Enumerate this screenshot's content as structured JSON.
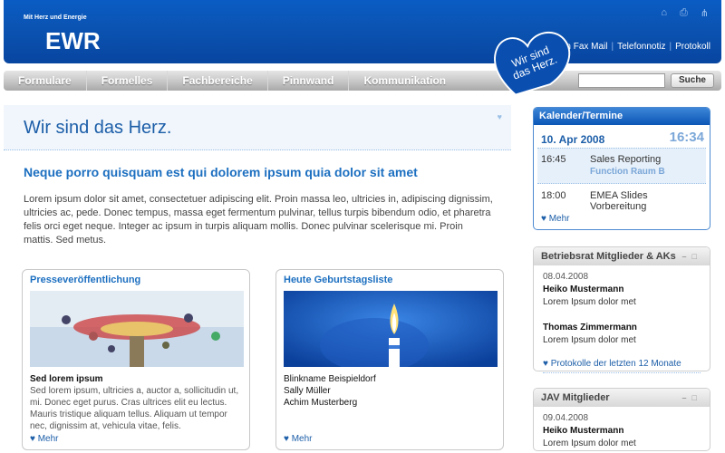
{
  "header": {
    "tagline": "Mit Herz und Energie",
    "logo": "EWR",
    "links": [
      "Fon Fax Mail",
      "Telefonnotiz",
      "Protokoll"
    ],
    "icons": [
      "home-icon",
      "print-icon",
      "sitemap-icon"
    ]
  },
  "nav": {
    "items": [
      "Formulare",
      "Formelles",
      "Fachbereiche",
      "Pinnwand",
      "Kommunikation"
    ]
  },
  "search": {
    "placeholder": "",
    "button_label": "Suche"
  },
  "badge": {
    "text": "Wir sind das Herz."
  },
  "main": {
    "title": "Wir sind das Herz.",
    "headline": "Neque porro quisquam est qui dolorem ipsum quia dolor sit amet",
    "intro": "Lorem ipsum dolor sit amet, consectetuer adipiscing elit. Proin massa leo, ultricies in, adipiscing dignissim, ultricies ac, pede. Donec tempus, massa eget fermentum pulvinar, tellus turpis bibendum odio, et pharetra felis orci eget neque. Integer ac ipsum in turpis aliquam mollis. Donec pulvinar scelerisque mi. Proin mattis. Sed metus."
  },
  "teasers": [
    {
      "title": "Presseveröffentlichung",
      "subtitle": "Sed lorem ipsum",
      "text": "Sed lorem ipsum, ultricies a, auctor a, sollicitudin ut, mi. Donec eget purus. Cras ultrices elit eu lectus. Mauris tristique aliquam tellus. Aliquam ut tempor nec, dignissim at, vehicula vitae, felis.",
      "more": "Mehr"
    },
    {
      "title": "Heute Geburtstagsliste",
      "lines": [
        "Blinkname Beispieldorf",
        "Sally Müller",
        "Achim Musterberg"
      ],
      "more": "Mehr"
    }
  ],
  "calendar": {
    "title": "Kalender/Termine",
    "date": "10. Apr 2008",
    "clock": "16:34",
    "events": [
      {
        "time": "16:45",
        "title": "Sales Reporting",
        "location": "Function Raum B"
      },
      {
        "time": "18:00",
        "title": "EMEA Slides Vorbereitung",
        "location": ""
      }
    ],
    "more": "Mehr"
  },
  "betriebsrat": {
    "title": "Betriebsrat Mitglieder & AKs",
    "date": "08.04.2008",
    "entries": [
      {
        "name": "Heiko Mustermann",
        "text": "Lorem Ipsum dolor met"
      },
      {
        "name": "Thomas Zimmermann",
        "text": "Lorem Ipsum dolor met"
      }
    ],
    "link": "Protokolle der letzten 12 Monate"
  },
  "jav": {
    "title": "JAV Mitglieder",
    "date": "09.04.2008",
    "entries": [
      {
        "name": "Heiko Mustermann",
        "text": "Lorem Ipsum dolor met"
      }
    ]
  }
}
